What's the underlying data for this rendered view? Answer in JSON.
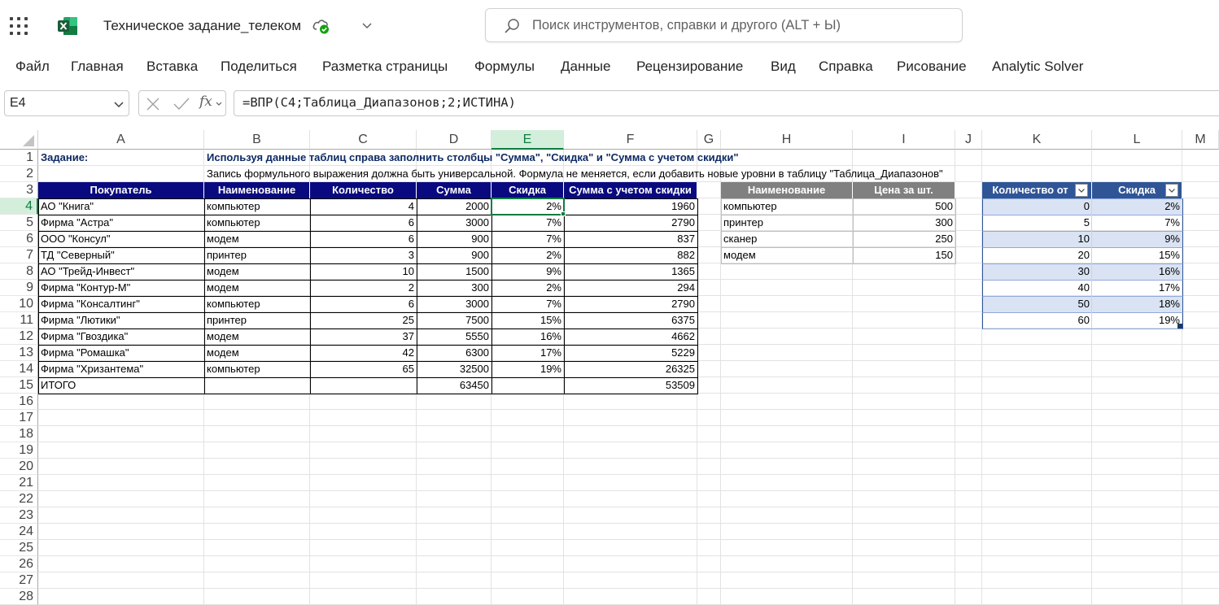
{
  "app": {
    "title": "Техническое задание_телеком",
    "search_placeholder": "Поиск инструментов, справки и другого (ALT + Ы)"
  },
  "ribbon": {
    "tabs": [
      "Файл",
      "Главная",
      "Вставка",
      "Поделиться",
      "Разметка страницы",
      "Формулы",
      "Данные",
      "Рецензирование",
      "Вид",
      "Справка",
      "Рисование",
      "Analytic Solver"
    ]
  },
  "formula_bar": {
    "name_box": "E4",
    "fx": "fx",
    "formula": "=ВПР(C4;Таблица_Диапазонов;2;ИСТИНА)"
  },
  "grid": {
    "columns": [
      "A",
      "B",
      "C",
      "D",
      "E",
      "F",
      "G",
      "H",
      "I",
      "J",
      "K",
      "L",
      "M"
    ],
    "selected_column": "E",
    "rows": [
      "1",
      "2",
      "3",
      "4",
      "5",
      "6",
      "7",
      "8",
      "9",
      "10",
      "11",
      "12",
      "13",
      "14",
      "15",
      "16",
      "17",
      "18",
      "19",
      "20",
      "21",
      "22",
      "23",
      "24",
      "25",
      "26",
      "27",
      "28"
    ],
    "selected_row": "4"
  },
  "content": {
    "a1": "Задание:",
    "b1": "Используя данные таблиц справа заполнить столбцы \"Сумма\", \"Скидка\" и \"Сумма с учетом скидки\"",
    "b2": "Запись формульного выражения должна быть универсальной. Формула не меняется, если добавить новые уровни в таблицу \"Таблица_Диапазонов\""
  },
  "orders_table": {
    "headers": [
      "Покупатель",
      "Наименование",
      "Количество",
      "Сумма",
      "Скидка",
      "Сумма с учетом скидки"
    ],
    "rows": [
      [
        "АО \"Книга\"",
        "компьютер",
        "4",
        "2000",
        "2%",
        "1960"
      ],
      [
        "Фирма \"Астра\"",
        "компьютер",
        "6",
        "3000",
        "7%",
        "2790"
      ],
      [
        "ООО \"Консул\"",
        "модем",
        "6",
        "900",
        "7%",
        "837"
      ],
      [
        "ТД \"Северный\"",
        "принтер",
        "3",
        "900",
        "2%",
        "882"
      ],
      [
        "АО \"Трейд-Инвест\"",
        "модем",
        "10",
        "1500",
        "9%",
        "1365"
      ],
      [
        "Фирма \"Контур-М\"",
        "модем",
        "2",
        "300",
        "2%",
        "294"
      ],
      [
        "Фирма \"Консалтинг\"",
        "компьютер",
        "6",
        "3000",
        "7%",
        "2790"
      ],
      [
        "Фирма \"Лютики\"",
        "принтер",
        "25",
        "7500",
        "15%",
        "6375"
      ],
      [
        "Фирма \"Гвоздика\"",
        "модем",
        "37",
        "5550",
        "16%",
        "4662"
      ],
      [
        "Фирма \"Ромашка\"",
        "модем",
        "42",
        "6300",
        "17%",
        "5229"
      ],
      [
        "Фирма \"Хризантема\"",
        "компьютер",
        "65",
        "32500",
        "19%",
        "26325"
      ]
    ],
    "total": [
      "ИТОГО",
      "",
      "",
      "63450",
      "",
      "53509"
    ]
  },
  "price_table": {
    "headers": [
      "Наименование",
      "Цена за шт."
    ],
    "rows": [
      [
        "компьютер",
        "500"
      ],
      [
        "принтер",
        "300"
      ],
      [
        "сканер",
        "250"
      ],
      [
        "модем",
        "150"
      ]
    ]
  },
  "ranges_table": {
    "headers": [
      "Количество от",
      "Скидка"
    ],
    "rows": [
      [
        "0",
        "2%"
      ],
      [
        "5",
        "7%"
      ],
      [
        "10",
        "9%"
      ],
      [
        "20",
        "15%"
      ],
      [
        "30",
        "16%"
      ],
      [
        "40",
        "17%"
      ],
      [
        "50",
        "18%"
      ],
      [
        "60",
        "19%"
      ]
    ]
  },
  "colors": {
    "excel_green": "#107c41",
    "orders_header": "#0a0a80",
    "price_header": "#808080",
    "ranges_header": "#2f5597",
    "ranges_band": "#dae3f3"
  }
}
